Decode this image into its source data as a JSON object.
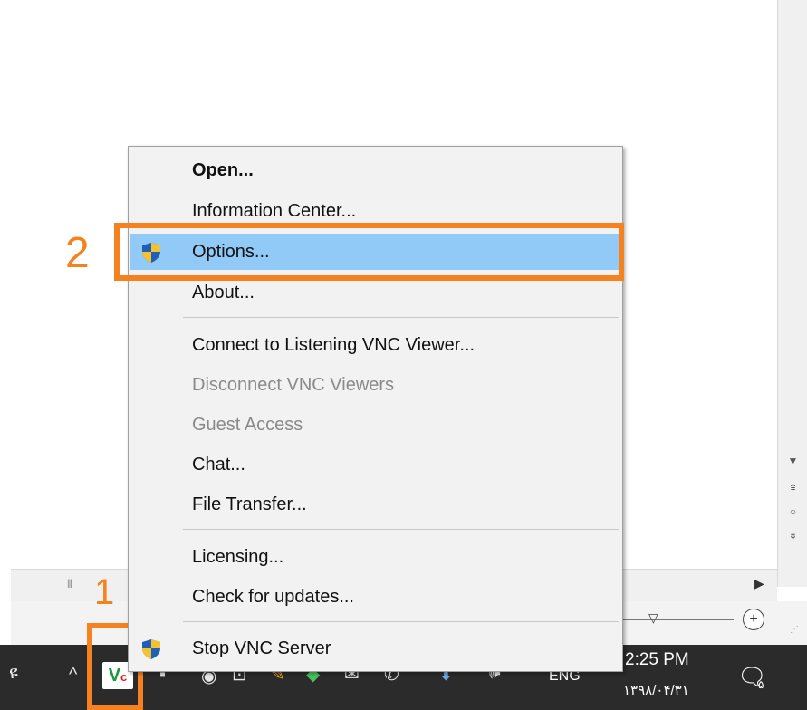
{
  "menu": {
    "items": [
      {
        "label": "Open...",
        "bold": true,
        "enabled": true
      },
      {
        "label": "Information Center...",
        "enabled": true
      },
      {
        "label": "Options...",
        "enabled": true,
        "highlighted": true,
        "icon": "uac-shield-icon"
      },
      {
        "label": "About...",
        "enabled": true
      },
      {
        "label": "Connect to Listening VNC Viewer...",
        "enabled": true
      },
      {
        "label": "Disconnect VNC Viewers",
        "enabled": false
      },
      {
        "label": "Guest Access",
        "enabled": false
      },
      {
        "label": "Chat...",
        "enabled": true
      },
      {
        "label": "File Transfer...",
        "enabled": true
      },
      {
        "label": "Licensing...",
        "enabled": true
      },
      {
        "label": "Check for updates...",
        "enabled": true
      },
      {
        "label": "Stop VNC Server",
        "enabled": true,
        "icon": "uac-shield-icon"
      }
    ]
  },
  "annotations": {
    "step1": "1",
    "step2": "2",
    "color": "#f5821f"
  },
  "taskbar": {
    "time": "2:25 PM",
    "date": "۱۳۹۸/۰۴/۳۱",
    "language": "ENG",
    "notification_count": "۵"
  },
  "colors": {
    "highlight": "#91c9f7",
    "menu_bg": "#f2f2f2",
    "taskbar_bg": "#2b2b2b"
  }
}
